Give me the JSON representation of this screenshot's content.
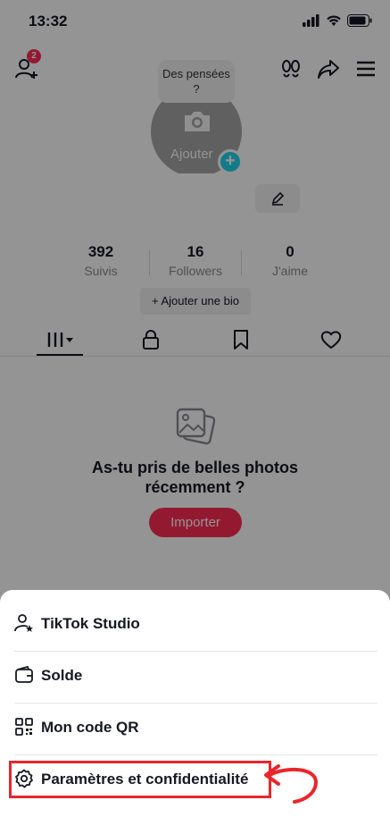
{
  "status_bar": {
    "time": "13:32"
  },
  "header": {
    "badge_count": "2"
  },
  "profile": {
    "bubble_text": "Des pensées ?",
    "avatar_add_label": "Ajouter",
    "stats": [
      {
        "value": "392",
        "label": "Suivis"
      },
      {
        "value": "16",
        "label": "Followers"
      },
      {
        "value": "0",
        "label": "J'aime"
      }
    ],
    "bio_button": "+ Ajouter une bio"
  },
  "empty_state": {
    "title": "As-tu pris de belles photos récemment ?",
    "button": "Importer"
  },
  "menu": {
    "items": [
      {
        "label": "TikTok Studio",
        "icon": "person-star-icon"
      },
      {
        "label": "Solde",
        "icon": "wallet-icon"
      },
      {
        "label": "Mon code QR",
        "icon": "qr-code-icon"
      },
      {
        "label": "Paramètres et confidentialité",
        "icon": "gear-icon"
      }
    ]
  },
  "colors": {
    "accent": "#fe2c55",
    "highlight": "#e8262b",
    "avatar_plus": "#20d5ec"
  }
}
